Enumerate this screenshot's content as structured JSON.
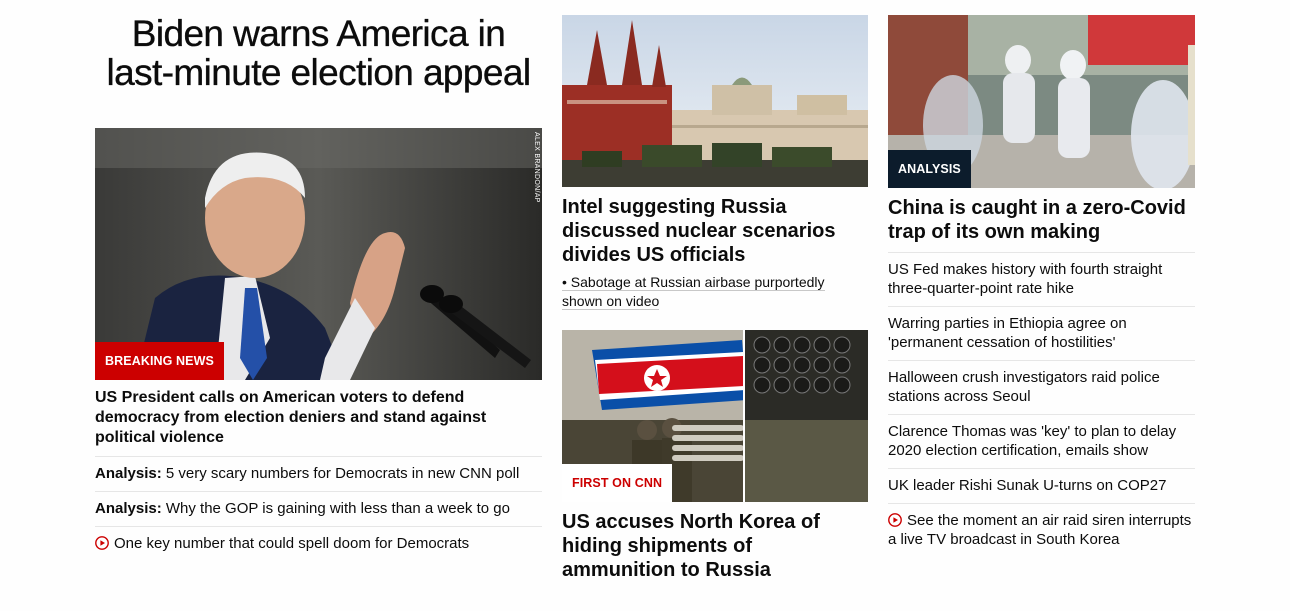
{
  "lead_story": {
    "headline": "Biden warns America in last-minute election appeal",
    "image_credit": "ALEX BRANDON/AP",
    "badge": "BREAKING NEWS",
    "summary": "US President calls on American voters to defend democracy from election deniers and stand against political violence",
    "related": [
      {
        "prefix": "Analysis:",
        "text": "5 very scary numbers for Democrats in new CNN poll",
        "icon": ""
      },
      {
        "prefix": "Analysis:",
        "text": "Why the GOP is gaining with less than a week to go",
        "icon": ""
      },
      {
        "prefix": "",
        "text": "One key number that could spell doom for Democrats",
        "icon": "play-icon"
      }
    ]
  },
  "middle_column": {
    "story1": {
      "headline": "Intel suggesting Russia discussed nuclear scenarios divides US officials",
      "bullet": "• Sabotage at Russian airbase purportedly shown on video"
    },
    "story2": {
      "badge": "FIRST ON CNN",
      "headline": "US accuses North Korea of hiding shipments of ammunition to Russia"
    }
  },
  "right_column": {
    "badge": "ANALYSIS",
    "headline": "China is caught in a zero-Covid trap of its own making",
    "links": [
      {
        "text": "US Fed makes history with fourth straight three-quarter-point rate hike",
        "icon": ""
      },
      {
        "text": "Warring parties in Ethiopia agree on 'permanent cessation of hostilities'",
        "icon": ""
      },
      {
        "text": "Halloween crush investigators raid police stations across Seoul",
        "icon": ""
      },
      {
        "text": "Clarence Thomas was 'key' to plan to delay 2020 election certification, emails show",
        "icon": ""
      },
      {
        "text": "UK leader Rishi Sunak U-turns on COP27",
        "icon": ""
      },
      {
        "text": "See the moment an air raid siren interrupts a live TV broadcast in South Korea",
        "icon": "play-icon"
      }
    ]
  },
  "colors": {
    "breaking_red": "#cc0000",
    "analysis_navy": "#0c1c2c",
    "text": "#0c0c0c",
    "divider": "#e6e6e6"
  }
}
